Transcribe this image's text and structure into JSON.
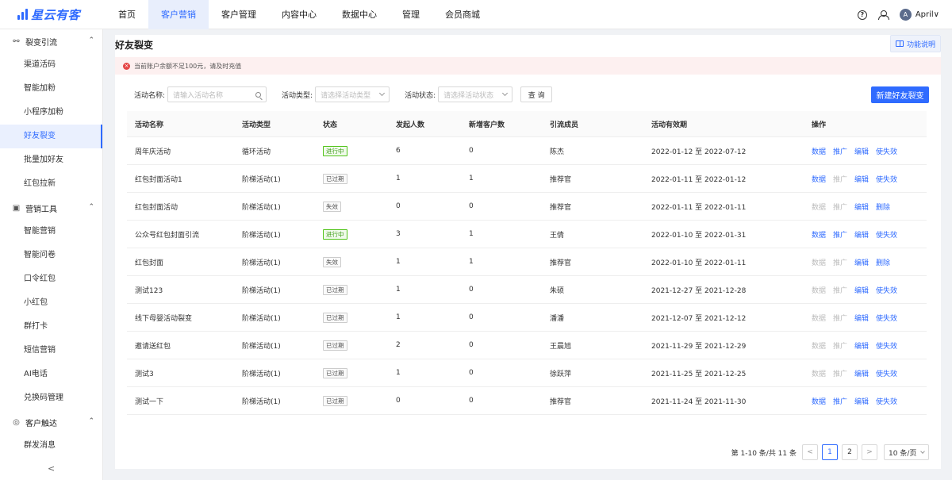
{
  "brand": {
    "name": "星云有客",
    "color": "#2f6bff"
  },
  "nav": {
    "items": [
      {
        "label": "首页"
      },
      {
        "label": "客户营销",
        "active": true
      },
      {
        "label": "客户管理"
      },
      {
        "label": "内容中心"
      },
      {
        "label": "数据中心"
      },
      {
        "label": "管理"
      },
      {
        "label": "会员商城"
      }
    ],
    "user": {
      "avatar_letter": "A",
      "name": "April",
      "dropdown": "∨"
    },
    "icons": [
      "help-icon",
      "user-switch-icon"
    ]
  },
  "sidebar": {
    "groups": [
      {
        "label": "裂变引流",
        "icon": "share-icon",
        "items": [
          "渠道活码",
          "智能加粉",
          "小程序加粉",
          "好友裂变",
          "批量加好友",
          "红包拉新"
        ],
        "active_item": "好友裂变"
      },
      {
        "label": "营销工具",
        "icon": "gift-icon",
        "items": [
          "智能营销",
          "智能问卷",
          "口令红包",
          "小红包",
          "群打卡",
          "短信营销",
          "AI电话",
          "兑换码管理"
        ]
      },
      {
        "label": "客户触达",
        "icon": "target-icon",
        "items": [
          "群发消息"
        ]
      }
    ],
    "collapse_glyph": "<"
  },
  "page": {
    "title": "好友裂变",
    "help_label": "功能说明",
    "alert": "当前账户余额不足100元，请及时充值"
  },
  "filters": {
    "name_label": "活动名称:",
    "name_placeholder": "请输入活动名称",
    "type_label": "活动类型:",
    "type_placeholder": "请选择活动类型",
    "status_label": "活动状态:",
    "status_placeholder": "请选择活动状态",
    "query_label": "查 询",
    "create_label": "新建好友裂变"
  },
  "table": {
    "columns": [
      "活动名称",
      "活动类型",
      "状态",
      "发起人数",
      "新增客户数",
      "引流成员",
      "活动有效期",
      "操作"
    ],
    "rows": [
      {
        "name": "周年庆活动",
        "type": "循环活动",
        "status": "进行中",
        "status_kind": "green",
        "initiators": "6",
        "new_customers": "0",
        "member": "陈杰",
        "period": "2022-01-12 至 2022-07-12",
        "ops": [
          "数据",
          "推广",
          "编辑",
          "使失效"
        ],
        "ops_disabled": []
      },
      {
        "name": "红包封面活动1",
        "type": "阶梯活动(1)",
        "status": "已过期",
        "status_kind": "grey",
        "initiators": "1",
        "new_customers": "1",
        "member": "推荐官",
        "period": "2022-01-11 至 2022-01-12",
        "ops": [
          "数据",
          "推广",
          "编辑",
          "使失效"
        ],
        "ops_disabled": [
          1
        ]
      },
      {
        "name": "红包封面活动",
        "type": "阶梯活动(1)",
        "status": "失效",
        "status_kind": "grey",
        "initiators": "0",
        "new_customers": "0",
        "member": "推荐官",
        "period": "2022-01-11 至 2022-01-11",
        "ops": [
          "数据",
          "推广",
          "编辑",
          "删除"
        ],
        "ops_disabled": [
          0,
          1
        ]
      },
      {
        "name": "公众号红包封面引流",
        "type": "阶梯活动(1)",
        "status": "进行中",
        "status_kind": "green",
        "initiators": "3",
        "new_customers": "1",
        "member": "王倩",
        "period": "2022-01-10 至 2022-01-31",
        "ops": [
          "数据",
          "推广",
          "编辑",
          "使失效"
        ],
        "ops_disabled": []
      },
      {
        "name": "红包封面",
        "type": "阶梯活动(1)",
        "status": "失效",
        "status_kind": "grey",
        "initiators": "1",
        "new_customers": "1",
        "member": "推荐官",
        "period": "2022-01-10 至 2022-01-11",
        "ops": [
          "数据",
          "推广",
          "编辑",
          "删除"
        ],
        "ops_disabled": [
          0,
          1
        ]
      },
      {
        "name": "测试123",
        "type": "阶梯活动(1)",
        "status": "已过期",
        "status_kind": "grey",
        "initiators": "1",
        "new_customers": "0",
        "member": "朱硕",
        "period": "2021-12-27 至 2021-12-28",
        "ops": [
          "数据",
          "推广",
          "编辑",
          "使失效"
        ],
        "ops_disabled": [
          0,
          1
        ]
      },
      {
        "name": "线下母婴活动裂变",
        "type": "阶梯活动(1)",
        "status": "已过期",
        "status_kind": "grey",
        "initiators": "1",
        "new_customers": "0",
        "member": "潘潘",
        "period": "2021-12-07 至 2021-12-12",
        "ops": [
          "数据",
          "推广",
          "编辑",
          "使失效"
        ],
        "ops_disabled": [
          0,
          1
        ]
      },
      {
        "name": "邀请送红包",
        "type": "阶梯活动(1)",
        "status": "已过期",
        "status_kind": "grey",
        "initiators": "2",
        "new_customers": "0",
        "member": "王晨旭",
        "period": "2021-11-29 至 2021-12-29",
        "ops": [
          "数据",
          "推广",
          "编辑",
          "使失效"
        ],
        "ops_disabled": [
          0,
          1
        ]
      },
      {
        "name": "测试3",
        "type": "阶梯活动(1)",
        "status": "已过期",
        "status_kind": "grey",
        "initiators": "1",
        "new_customers": "0",
        "member": "徐跃萍",
        "period": "2021-11-25 至 2021-12-25",
        "ops": [
          "数据",
          "推广",
          "编辑",
          "使失效"
        ],
        "ops_disabled": [
          0,
          1
        ]
      },
      {
        "name": "测试一下",
        "type": "阶梯活动(1)",
        "status": "已过期",
        "status_kind": "grey",
        "initiators": "0",
        "new_customers": "0",
        "member": "推荐官",
        "period": "2021-11-24 至 2021-11-30",
        "ops": [
          "数据",
          "推广",
          "编辑",
          "使失效"
        ],
        "ops_disabled": []
      }
    ]
  },
  "pagination": {
    "summary": "第 1-10 条/共 11 条",
    "prev": "<",
    "pages": [
      "1",
      "2"
    ],
    "current": "1",
    "next": ">",
    "page_size": "10 条/页"
  }
}
